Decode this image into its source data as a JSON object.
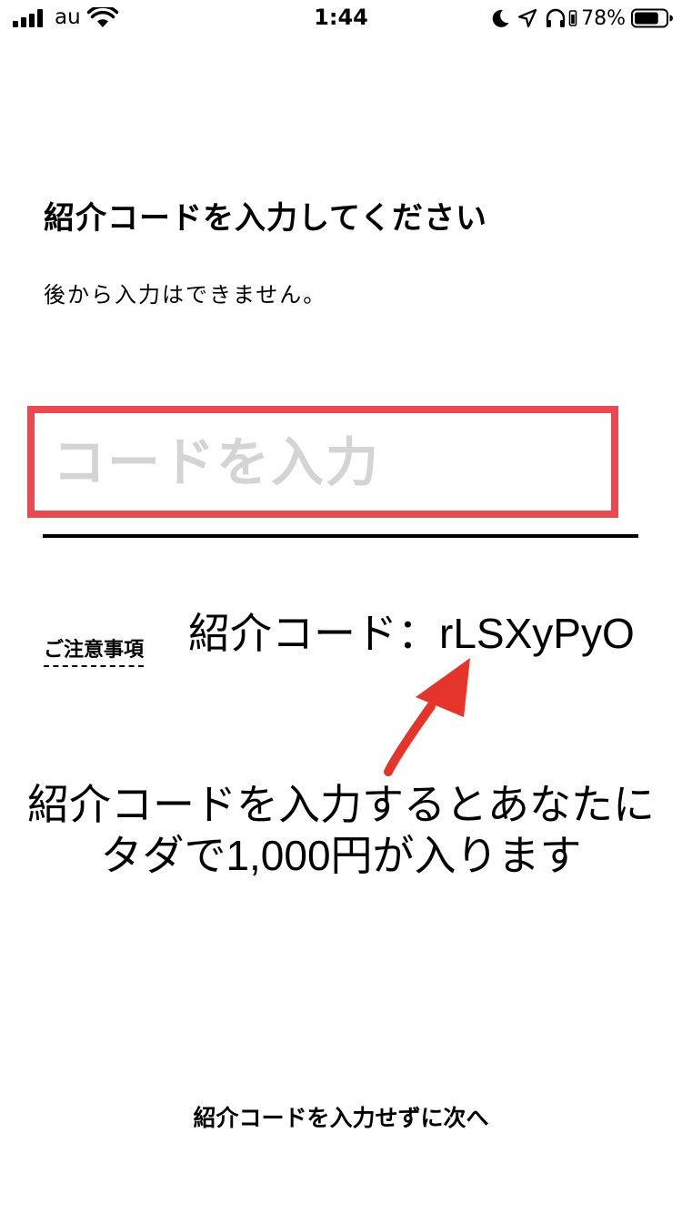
{
  "status_bar": {
    "carrier": "au",
    "time": "1:44",
    "battery_percent": "78%",
    "battery_level": 0.78,
    "icons": [
      "signal-icon",
      "wifi-icon",
      "moon-icon",
      "location-arrow-icon",
      "headphones-icon",
      "battery-icon"
    ]
  },
  "main": {
    "heading": "紹介コードを入力してください",
    "subtext": "後から入力はできません。",
    "input": {
      "placeholder": "コードを入力",
      "value": ""
    },
    "notes_link": "ご注意事項",
    "skip_button": "紹介コードを入力せずに次へ"
  },
  "annotation": {
    "code_label": "紹介コード：rLSXyPyO",
    "message_line1": "紹介コードを入力するとあなたに",
    "message_line2": "タダで1,000円が入ります",
    "arrow_color": "#e5342a",
    "highlight_color": "#e84a50"
  }
}
